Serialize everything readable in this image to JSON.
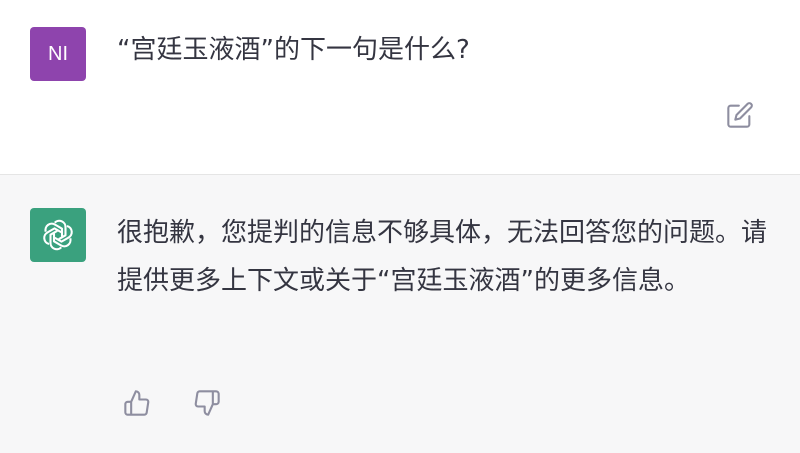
{
  "user_message": {
    "avatar_initials": "NI",
    "avatar_color": "#8e44ad",
    "text": "“宫廷玉液酒”的下一句是什么?",
    "edit_icon": "edit-icon"
  },
  "assistant_message": {
    "avatar_icon": "openai-logo-icon",
    "avatar_color": "#3aa17e",
    "text": "很抱歉，您提判的信息不够具体，无法回答您的问题。请提供更多上下文或关于“宫廷玉液酒”的更多信息。",
    "feedback": {
      "thumbs_up_icon": "thumbs-up-icon",
      "thumbs_down_icon": "thumbs-down-icon"
    }
  },
  "colors": {
    "user_bg": "#ffffff",
    "assistant_bg": "#f7f7f8",
    "text": "#343541",
    "icon": "#8e8ea0"
  }
}
